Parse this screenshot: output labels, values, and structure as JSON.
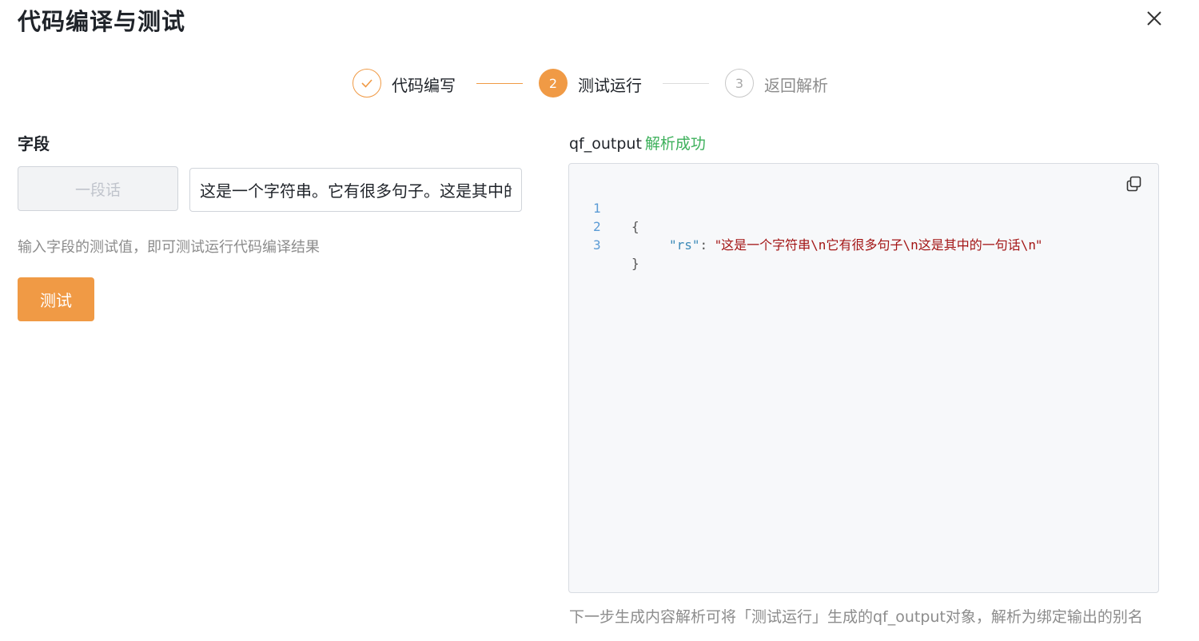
{
  "dialog": {
    "title": "代码编译与测试"
  },
  "steps": [
    {
      "label": "代码编写",
      "index": "1",
      "state": "done"
    },
    {
      "label": "测试运行",
      "index": "2",
      "state": "active"
    },
    {
      "label": "返回解析",
      "index": "3",
      "state": "todo"
    }
  ],
  "left": {
    "section_label": "字段",
    "field_name": "一段话",
    "field_value": "这是一个字符串。它有很多句子。这是其中的一句话。",
    "hint": "输入字段的测试值，即可测试运行代码编译结果",
    "test_button": "测试"
  },
  "right": {
    "output_name": "qf_output",
    "status": "解析成功",
    "code": {
      "line_numbers": [
        "1",
        "2",
        "3"
      ],
      "open_brace": "{",
      "key": "\"rs\"",
      "colon": ": ",
      "value_parts": [
        "\"这是一个字符串",
        "\\n",
        "它有很多句子",
        "\\n",
        "这是其中的一句话",
        "\\n",
        "\""
      ],
      "close_brace": "}"
    },
    "footer_note": "下一步生成内容解析可将「测试运行」生成的qf_output对象，解析为绑定输出的别名"
  },
  "colors": {
    "accent": "#f09a45",
    "success": "#3db05b"
  }
}
